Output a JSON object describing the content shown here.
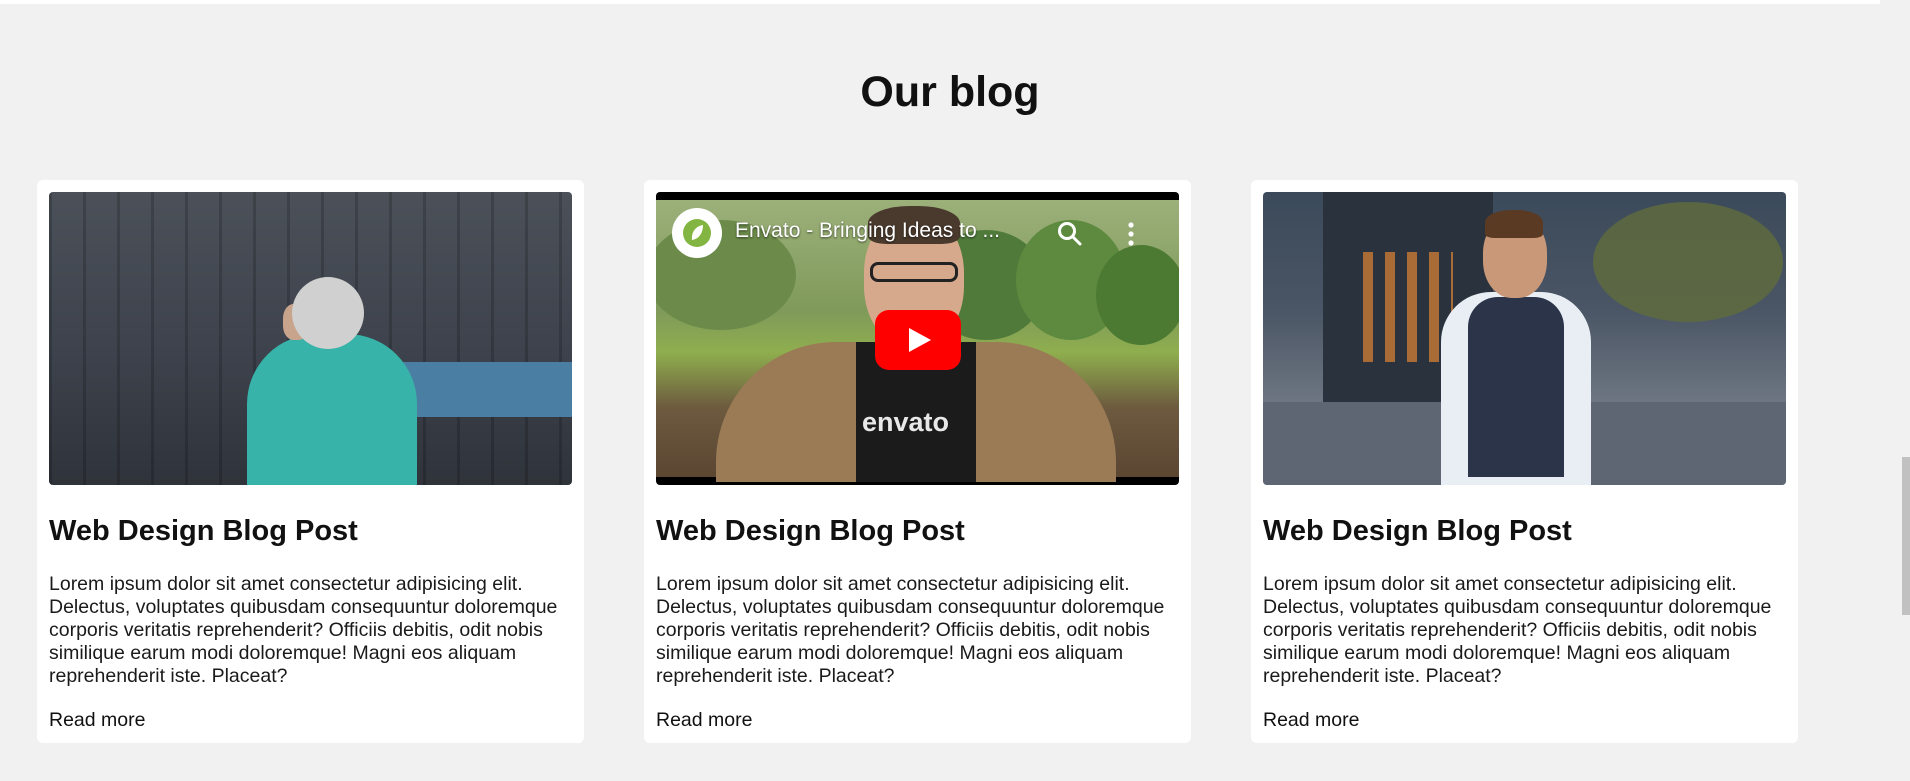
{
  "section": {
    "title": "Our blog"
  },
  "posts": [
    {
      "title": "Web Design Blog Post",
      "text": "Lorem ipsum dolor sit amet consectetur adipisicing elit. Delectus, voluptates quibusdam consequuntur doloremque corporis veritatis reprehenderit? Officiis debitis, odit nobis similique earum modi doloremque! Magni eos aliquam reprehenderit iste. Placeat?",
      "link": "Read more"
    },
    {
      "title": "Web Design Blog Post",
      "text": "Lorem ipsum dolor sit amet consectetur adipisicing elit. Delectus, voluptates quibusdam consequuntur doloremque corporis veritatis reprehenderit? Officiis debitis, odit nobis similique earum modi doloremque! Magni eos aliquam reprehenderit iste. Placeat?",
      "link": "Read more",
      "video": {
        "title": "Envato - Bringing Ideas to ...",
        "shirt_text": "envato"
      }
    },
    {
      "title": "Web Design Blog Post",
      "text": "Lorem ipsum dolor sit amet consectetur adipisicing elit. Delectus, voluptates quibusdam consequuntur doloremque corporis veritatis reprehenderit? Officiis debitis, odit nobis similique earum modi doloremque! Magni eos aliquam reprehenderit iste. Placeat?",
      "link": "Read more"
    }
  ],
  "colors": {
    "page_bg": "#f1f1f1",
    "card_bg": "#ffffff",
    "youtube_red": "#ff0000",
    "envato_green": "#82b541"
  }
}
